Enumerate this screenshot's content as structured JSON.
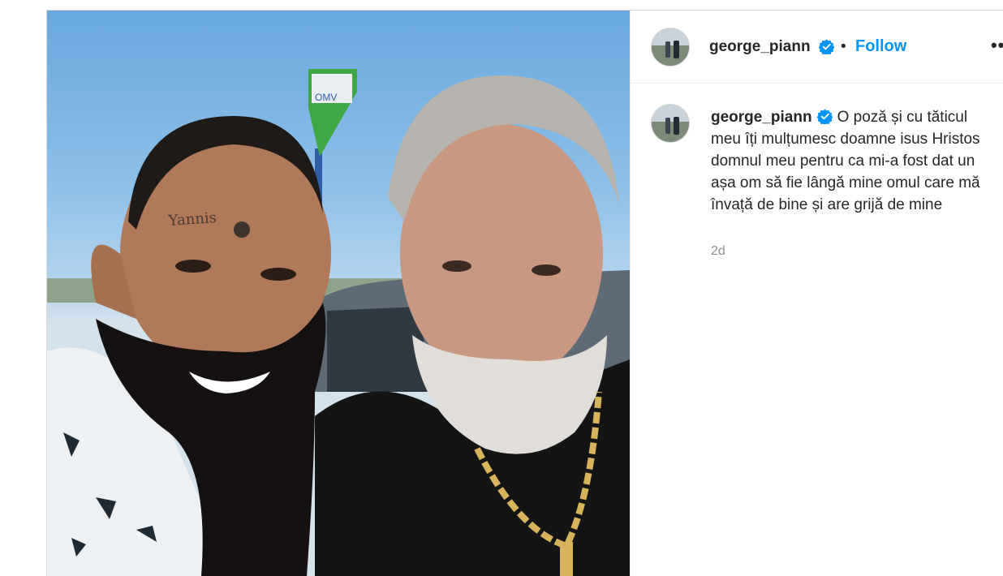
{
  "post": {
    "username": "george_piann",
    "follow_label": "Follow",
    "separator": "•",
    "more_label": "••",
    "caption_text": "O poză și cu tăticul meu îți mulțumesc doamne isus Hristos domnul meu pentru ca mi-a fost dat un așa om să fie lângă mine omul care mă învață de bine și are grijă de mine",
    "time_ago": "2d"
  },
  "photo": {
    "sign_brand": "OMV",
    "forehead_tattoo": "Yannis"
  },
  "colors": {
    "accent": "#0095f6",
    "verified": "#0095f6",
    "text": "#262626",
    "muted": "#8e8e8e",
    "border": "#efefef"
  },
  "icons": {
    "verified": "verified-badge-icon",
    "more": "more-options-icon"
  }
}
